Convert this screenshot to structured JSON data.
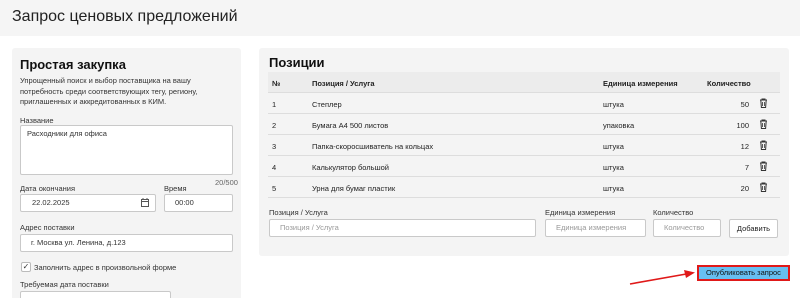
{
  "page": {
    "title": "Запрос ценовых предложений"
  },
  "left_panel": {
    "title": "Простая закупка",
    "description": "Упрощенный поиск и выбор поставщика на вашу потребность среди соответствующих тегу, региону, приглашенных и аккредитованных в КИМ.",
    "name_label": "Название",
    "name_value": "Расходники для офиса",
    "name_counter": "20/500",
    "end_date_label": "Дата окончания",
    "end_date_value": "22.02.2025",
    "time_label": "Время",
    "time_value": "00:00",
    "address_label": "Адрес поставки",
    "address_value": "г. Москва ул. Ленина, д.123",
    "free_address_checkbox_label": "Заполнить адрес в произвольной форме",
    "free_address_checked": true,
    "required_delivery_label": "Требуемая дата поставки"
  },
  "positions": {
    "title": "Позиции",
    "columns": [
      "№",
      "Позиция / Услуга",
      "Единица измерения",
      "Количество"
    ],
    "rows": [
      {
        "num": "1",
        "item": "Степлер",
        "unit": "штука",
        "qty": "50"
      },
      {
        "num": "2",
        "item": "Бумага А4 500 листов",
        "unit": "упаковка",
        "qty": "100"
      },
      {
        "num": "3",
        "item": "Папка-скоросшиватель на кольцах",
        "unit": "штука",
        "qty": "12"
      },
      {
        "num": "4",
        "item": "Калькулятор большой",
        "unit": "штука",
        "qty": "7"
      },
      {
        "num": "5",
        "item": "Урна для бумаг пластик",
        "unit": "штука",
        "qty": "20"
      }
    ],
    "add_form": {
      "item_label": "Позиция / Услуга",
      "item_placeholder": "Позиция / Услуга",
      "unit_label": "Единица измерения",
      "unit_placeholder": "Единица измерения",
      "qty_label": "Количество",
      "qty_placeholder": "Количество",
      "add_button": "Добавить"
    }
  },
  "actions": {
    "publish_button": "Опубликовать запрос"
  },
  "colors": {
    "publish_bg": "#67bff1",
    "highlight": "#e01919"
  },
  "icons": [
    "calendar-icon",
    "trash-icon",
    "check-icon",
    "arrow-icon"
  ]
}
